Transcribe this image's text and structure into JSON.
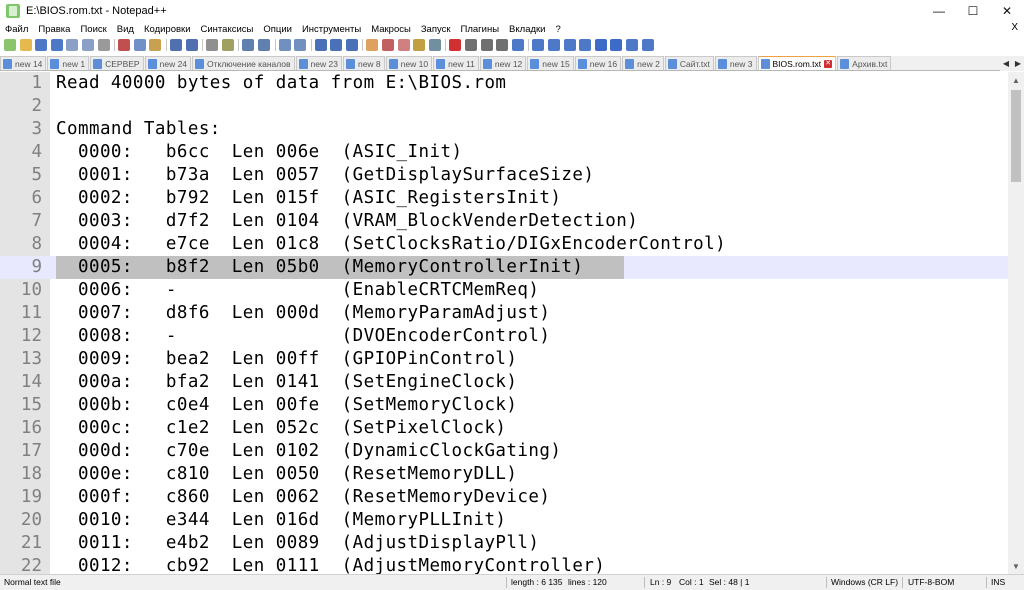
{
  "window": {
    "title": "E:\\BIOS.rom.txt - Notepad++",
    "minimize": "—",
    "maximize": "☐",
    "close": "✕"
  },
  "menu": {
    "items": [
      "Файл",
      "Правка",
      "Поиск",
      "Вид",
      "Кодировки",
      "Синтаксисы",
      "Опции",
      "Инструменты",
      "Макросы",
      "Запуск",
      "Плагины",
      "Вкладки",
      "?"
    ],
    "close_doc": "X"
  },
  "toolbar": {
    "icons": [
      {
        "name": "new-file-icon",
        "color": "#8cc46c"
      },
      {
        "name": "open-file-icon",
        "color": "#e5b94d"
      },
      {
        "name": "save-icon",
        "color": "#4d79c8"
      },
      {
        "name": "save-all-icon",
        "color": "#4d79c8"
      },
      {
        "name": "close-icon",
        "color": "#8aa0c8"
      },
      {
        "name": "close-all-icon",
        "color": "#8aa0c8"
      },
      {
        "name": "print-icon",
        "color": "#9a9a9a"
      },
      {
        "name": "sep"
      },
      {
        "name": "cut-icon",
        "color": "#c05050"
      },
      {
        "name": "copy-icon",
        "color": "#7090c8"
      },
      {
        "name": "paste-icon",
        "color": "#c8a050"
      },
      {
        "name": "sep"
      },
      {
        "name": "undo-icon",
        "color": "#5070b0"
      },
      {
        "name": "redo-icon",
        "color": "#5070b0"
      },
      {
        "name": "sep"
      },
      {
        "name": "find-icon",
        "color": "#909090"
      },
      {
        "name": "replace-icon",
        "color": "#a0a060"
      },
      {
        "name": "sep"
      },
      {
        "name": "zoom-in-icon",
        "color": "#6080b0"
      },
      {
        "name": "zoom-out-icon",
        "color": "#6080b0"
      },
      {
        "name": "sep"
      },
      {
        "name": "sync-vertical-icon",
        "color": "#7090c0"
      },
      {
        "name": "sync-horizontal-icon",
        "color": "#7090c0"
      },
      {
        "name": "sep"
      },
      {
        "name": "word-wrap-icon",
        "color": "#4a70b8"
      },
      {
        "name": "show-all-chars-icon",
        "color": "#4a70b8"
      },
      {
        "name": "indent-guide-icon",
        "color": "#4a70b8"
      },
      {
        "name": "sep"
      },
      {
        "name": "udl-icon",
        "color": "#e0a060"
      },
      {
        "name": "doc-map-icon",
        "color": "#c06060"
      },
      {
        "name": "function-list-icon",
        "color": "#d08080"
      },
      {
        "name": "folder-workspace-icon",
        "color": "#c0a040"
      },
      {
        "name": "monitoring-icon",
        "color": "#7090a0"
      },
      {
        "name": "sep"
      },
      {
        "name": "record-macro-icon",
        "color": "#d03030"
      },
      {
        "name": "stop-macro-icon",
        "color": "#707070"
      },
      {
        "name": "play-macro-icon",
        "color": "#707070"
      },
      {
        "name": "run-macro-multiple-icon",
        "color": "#707070"
      },
      {
        "name": "save-macro-icon",
        "color": "#4d79c8"
      },
      {
        "name": "sep"
      },
      {
        "name": "compare-icon",
        "color": "#4d79c8"
      },
      {
        "name": "compare-next-icon",
        "color": "#4d79c8"
      },
      {
        "name": "compare-prev-icon",
        "color": "#4d79c8"
      },
      {
        "name": "compare-first-icon",
        "color": "#4d79c8"
      },
      {
        "name": "arrow-up-icon",
        "color": "#3d6cc8"
      },
      {
        "name": "arrow-down-icon",
        "color": "#3d6cc8"
      },
      {
        "name": "compare-last-icon",
        "color": "#4d79c8"
      },
      {
        "name": "compare-settings-icon",
        "color": "#4d79c8"
      }
    ]
  },
  "tabs": {
    "items": [
      {
        "label": "new 14",
        "active": false
      },
      {
        "label": "new 1",
        "active": false
      },
      {
        "label": "СЕРВЕР",
        "active": false
      },
      {
        "label": "new 24",
        "active": false
      },
      {
        "label": "Отключение каналов",
        "active": false
      },
      {
        "label": "new 23",
        "active": false
      },
      {
        "label": "new 8",
        "active": false
      },
      {
        "label": "new 10",
        "active": false
      },
      {
        "label": "new 11",
        "active": false
      },
      {
        "label": "new 12",
        "active": false
      },
      {
        "label": "new 15",
        "active": false
      },
      {
        "label": "new 16",
        "active": false
      },
      {
        "label": "new 2",
        "active": false
      },
      {
        "label": "Сайт.txt",
        "active": false
      },
      {
        "label": "new 3",
        "active": false
      },
      {
        "label": "BIOS.rom.txt",
        "active": true
      },
      {
        "label": "Архив.txt",
        "active": false
      }
    ],
    "close_glyph": "✕",
    "nav_left": "◀",
    "nav_right": "▶"
  },
  "editor": {
    "current_line": 9,
    "lines": [
      {
        "num": "1",
        "text": "Read 40000 bytes of data from E:\\BIOS.rom"
      },
      {
        "num": "2",
        "text": ""
      },
      {
        "num": "3",
        "text": "Command Tables:"
      },
      {
        "num": "4",
        "text": "  0000:   b6cc  Len 006e  (ASIC_Init)"
      },
      {
        "num": "5",
        "text": "  0001:   b73a  Len 0057  (GetDisplaySurfaceSize)"
      },
      {
        "num": "6",
        "text": "  0002:   b792  Len 015f  (ASIC_RegistersInit)"
      },
      {
        "num": "7",
        "text": "  0003:   d7f2  Len 0104  (VRAM_BlockVenderDetection)"
      },
      {
        "num": "8",
        "text": "  0004:   e7ce  Len 01c8  (SetClocksRatio/DIGxEncoderControl)"
      },
      {
        "num": "9",
        "text": "  0005:   b8f2  Len 05b0  (MemoryControllerInit)"
      },
      {
        "num": "10",
        "text": "  0006:   -               (EnableCRTCMemReq)"
      },
      {
        "num": "11",
        "text": "  0007:   d8f6  Len 000d  (MemoryParamAdjust)"
      },
      {
        "num": "12",
        "text": "  0008:   -               (DVOEncoderControl)"
      },
      {
        "num": "13",
        "text": "  0009:   bea2  Len 00ff  (GPIOPinControl)"
      },
      {
        "num": "14",
        "text": "  000a:   bfa2  Len 0141  (SetEngineClock)"
      },
      {
        "num": "15",
        "text": "  000b:   c0e4  Len 00fe  (SetMemoryClock)"
      },
      {
        "num": "16",
        "text": "  000c:   c1e2  Len 052c  (SetPixelClock)"
      },
      {
        "num": "17",
        "text": "  000d:   c70e  Len 0102  (DynamicClockGating)"
      },
      {
        "num": "18",
        "text": "  000e:   c810  Len 0050  (ResetMemoryDLL)"
      },
      {
        "num": "19",
        "text": "  000f:   c860  Len 0062  (ResetMemoryDevice)"
      },
      {
        "num": "20",
        "text": "  0010:   e344  Len 016d  (MemoryPLLInit)"
      },
      {
        "num": "21",
        "text": "  0011:   e4b2  Len 0089  (AdjustDisplayPll)"
      },
      {
        "num": "22",
        "text": "  0012:   cb92  Len 0111  (AdjustMemoryController)"
      }
    ]
  },
  "scrollbar": {
    "up": "▲",
    "down": "▼"
  },
  "status": {
    "type": "Normal text file",
    "length": "length : 6 135",
    "lines": "lines : 120",
    "ln": "Ln : 9",
    "col": "Col : 1",
    "sel": "Sel : 48 | 1",
    "eol": "Windows (CR LF)",
    "encoding": "UTF-8-BOM",
    "mode": "INS"
  }
}
